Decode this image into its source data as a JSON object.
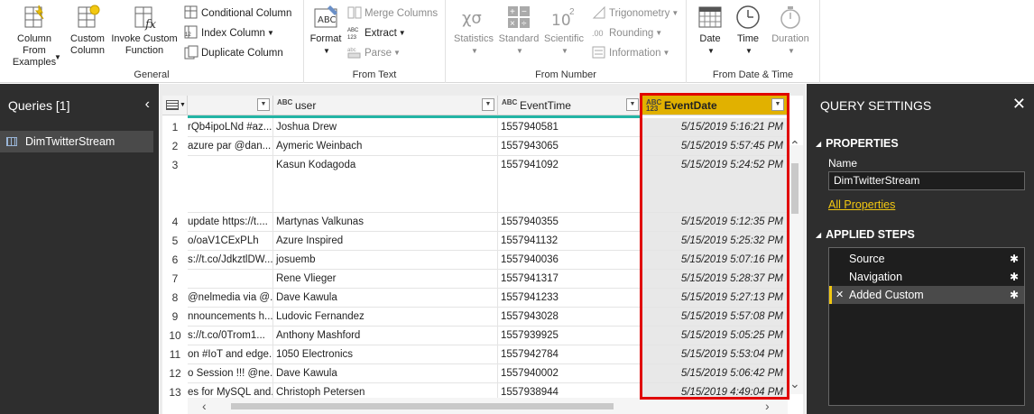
{
  "ribbon": {
    "general": {
      "label": "General",
      "column_from_examples": "Column From Examples",
      "custom_column": "Custom Column",
      "invoke_custom_function": "Invoke Custom Function",
      "conditional_column": "Conditional Column",
      "index_column": "Index Column",
      "duplicate_column": "Duplicate Column"
    },
    "from_text": {
      "label": "From Text",
      "format": "Format",
      "merge_columns": "Merge Columns",
      "extract": "Extract",
      "parse": "Parse"
    },
    "from_number": {
      "label": "From Number",
      "statistics": "Statistics",
      "standard": "Standard",
      "scientific": "Scientific",
      "trigonometry": "Trigonometry",
      "rounding": "Rounding",
      "information": "Information"
    },
    "from_date_time": {
      "label": "From Date & Time",
      "date": "Date",
      "time": "Time",
      "duration": "Duration"
    }
  },
  "queries": {
    "title": "Queries [1]",
    "items": [
      "DimTwitterStream"
    ]
  },
  "grid": {
    "columns": [
      {
        "type": "",
        "name": ""
      },
      {
        "type": "ABC",
        "name": "user"
      },
      {
        "type": "ABC",
        "name": "EventTime"
      },
      {
        "type": "ABC 123",
        "name": "EventDate"
      }
    ],
    "rows": [
      {
        "n": "1",
        "text": "rQb4ipoLNd #az...",
        "user": "Joshua Drew",
        "time": "1557940581",
        "date": "5/15/2019 5:16:21 PM"
      },
      {
        "n": "2",
        "text": "azure  par @dan...",
        "user": "Aymeric Weinbach",
        "time": "1557943065",
        "date": "5/15/2019 5:57:45 PM"
      },
      {
        "n": "3",
        "text": "",
        "user": "Kasun Kodagoda",
        "time": "1557941092",
        "date": "5/15/2019 5:24:52 PM"
      },
      {
        "n": "4",
        "text": "update https://t....",
        "user": "Martynas Valkunas",
        "time": "1557940355",
        "date": "5/15/2019 5:12:35 PM"
      },
      {
        "n": "5",
        "text": "o/oaV1CExPLh",
        "user": "Azure Inspired",
        "time": "1557941132",
        "date": "5/15/2019 5:25:32 PM"
      },
      {
        "n": "6",
        "text": "s://t.co/JdkztlDW...",
        "user": "josuemb",
        "time": "1557940036",
        "date": "5/15/2019 5:07:16 PM"
      },
      {
        "n": "7",
        "text": "",
        "user": "Rene Vlieger",
        "time": "1557941317",
        "date": "5/15/2019 5:28:37 PM"
      },
      {
        "n": "8",
        "text": "@nelmedia via @...",
        "user": "Dave Kawula",
        "time": "1557941233",
        "date": "5/15/2019 5:27:13 PM"
      },
      {
        "n": "9",
        "text": "nnouncements h...",
        "user": "Ludovic Fernandez",
        "time": "1557943028",
        "date": "5/15/2019 5:57:08 PM"
      },
      {
        "n": "10",
        "text": "s://t.co/0Trom1...",
        "user": "Anthony Mashford",
        "time": "1557939925",
        "date": "5/15/2019 5:05:25 PM"
      },
      {
        "n": "11",
        "text": "on #IoT and edge...",
        "user": "1050 Electronics",
        "time": "1557942784",
        "date": "5/15/2019 5:53:04 PM"
      },
      {
        "n": "12",
        "text": "o Session !!! @ne...",
        "user": "Dave Kawula",
        "time": "1557940002",
        "date": "5/15/2019 5:06:42 PM"
      },
      {
        "n": "13",
        "text": "es for MySQL and...",
        "user": "Christoph Petersen",
        "time": "1557938944",
        "date": "5/15/2019 4:49:04 PM"
      }
    ]
  },
  "settings": {
    "title": "QUERY SETTINGS",
    "properties_label": "PROPERTIES",
    "name_label": "Name",
    "name_value": "DimTwitterStream",
    "all_properties": "All Properties",
    "applied_steps_label": "APPLIED STEPS",
    "steps": [
      "Source",
      "Navigation",
      "Added Custom"
    ]
  },
  "colors": {
    "accent_yellow": "#e1b100",
    "highlight_red": "#e00000",
    "teal_bar": "#23b5a5",
    "dark_pane": "#2e2e2e"
  }
}
